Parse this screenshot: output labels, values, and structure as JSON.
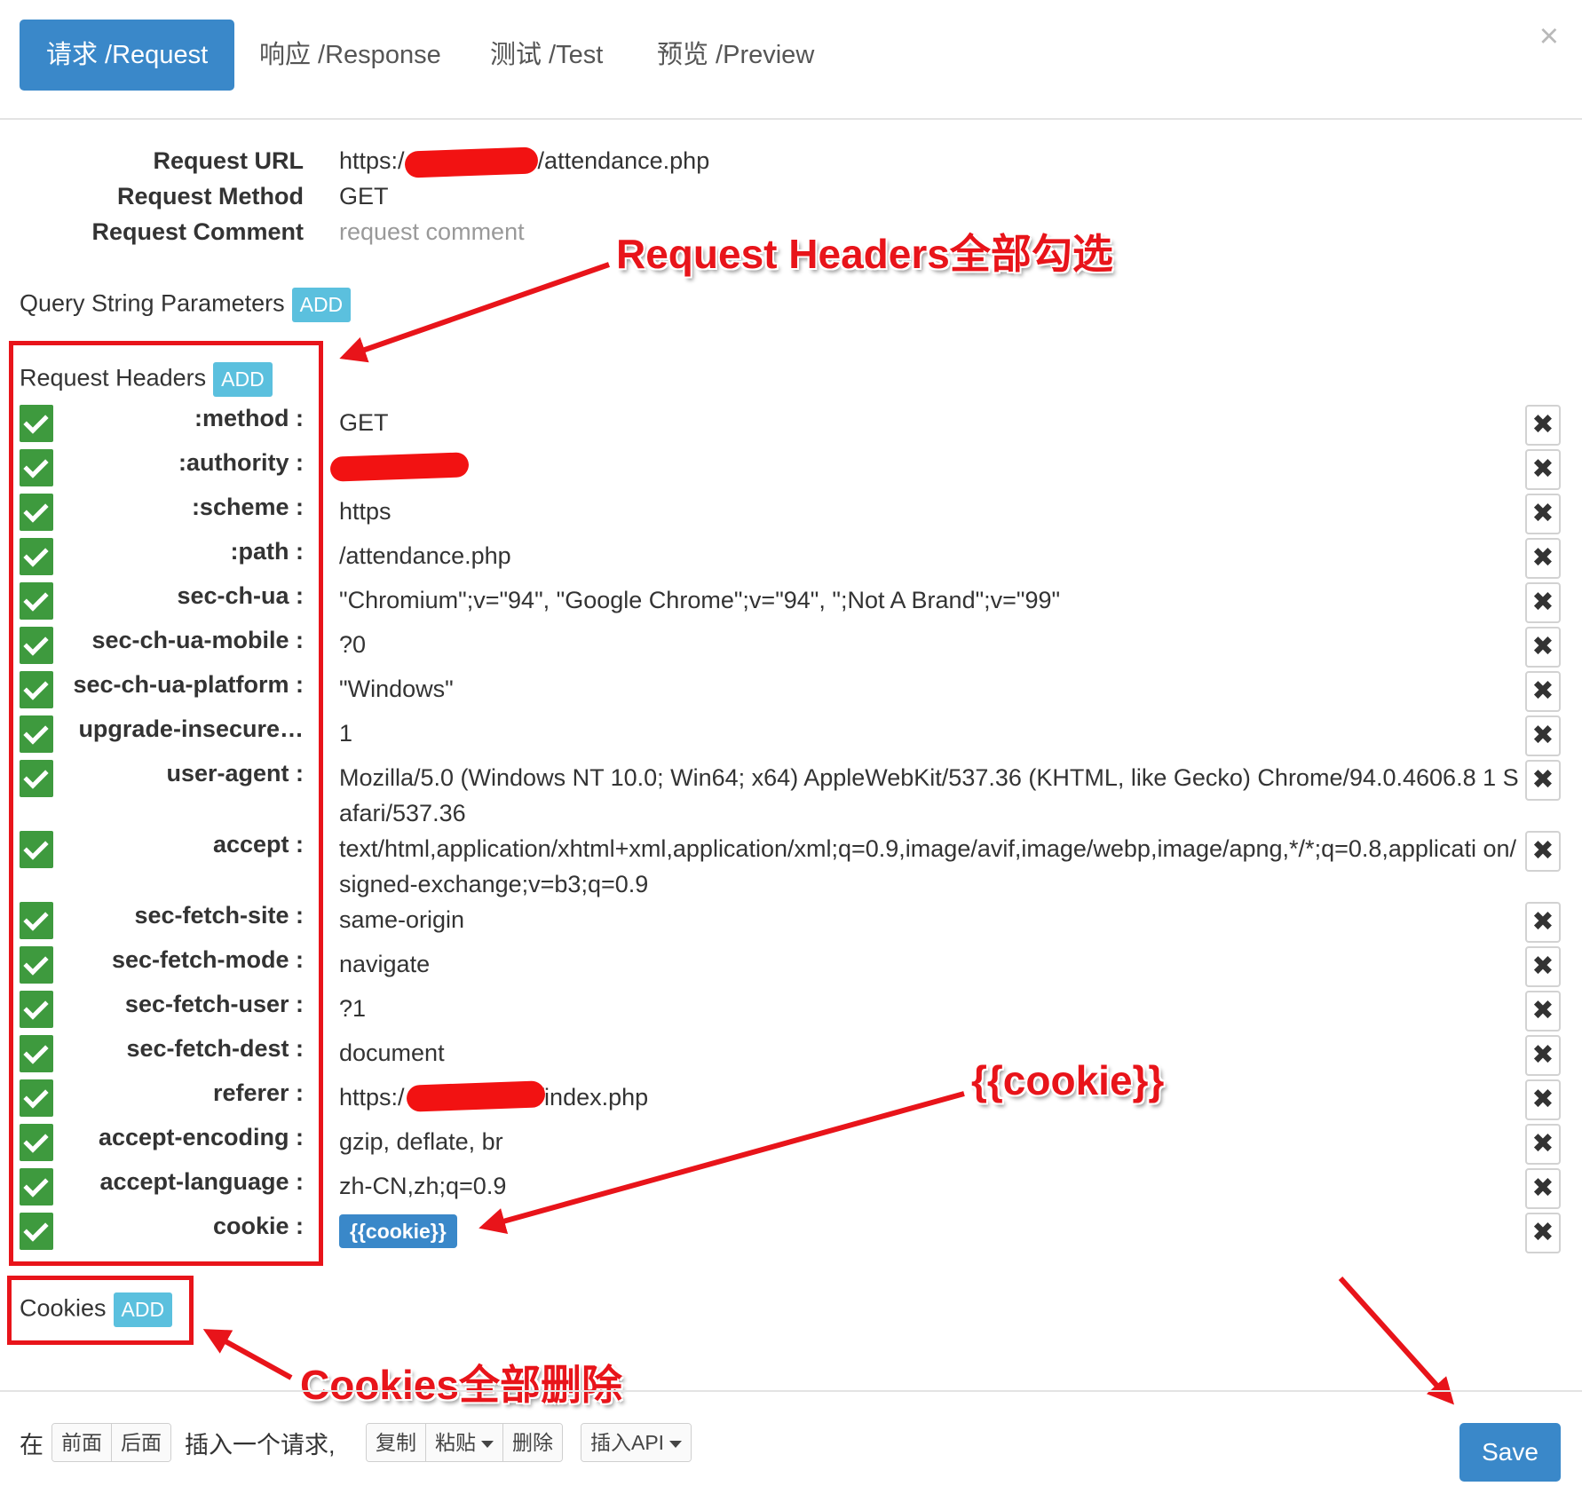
{
  "tabs": [
    "请求 /Request",
    "响应 /Response",
    "测试 /Test",
    "预览 /Preview"
  ],
  "close_icon": "×",
  "request": {
    "url_label": "Request URL",
    "url_prefix": "https:/",
    "url_suffix": "/attendance.php",
    "method_label": "Request Method",
    "method": "GET",
    "comment_label": "Request Comment",
    "comment_placeholder": "request comment"
  },
  "sections": {
    "query_label": "Query String Parameters",
    "headers_label": "Request Headers",
    "cookies_label": "Cookies",
    "add_label": "ADD"
  },
  "headers": [
    {
      "key": ":method :",
      "value": "GET"
    },
    {
      "key": ":authority :",
      "value": ""
    },
    {
      "key": ":scheme :",
      "value": "https"
    },
    {
      "key": ":path :",
      "value": "/attendance.php"
    },
    {
      "key": "sec-ch-ua :",
      "value": "\"Chromium\";v=\"94\", \"Google Chrome\";v=\"94\", \";Not A Brand\";v=\"99\""
    },
    {
      "key": "sec-ch-ua-mobile :",
      "value": "?0"
    },
    {
      "key": "sec-ch-ua-platform :",
      "value": "\"Windows\""
    },
    {
      "key": "upgrade-insecure…",
      "value": "1"
    },
    {
      "key": "user-agent :",
      "value": "Mozilla/5.0 (Windows NT 10.0; Win64; x64) AppleWebKit/537.36 (KHTML, like Gecko) Chrome/94.0.4606.8 1 Safari/537.36"
    },
    {
      "key": "accept :",
      "value": "text/html,application/xhtml+xml,application/xml;q=0.9,image/avif,image/webp,image/apng,*/*;q=0.8,applicati on/signed-exchange;v=b3;q=0.9"
    },
    {
      "key": "sec-fetch-site :",
      "value": "same-origin"
    },
    {
      "key": "sec-fetch-mode :",
      "value": "navigate"
    },
    {
      "key": "sec-fetch-user :",
      "value": "?1"
    },
    {
      "key": "sec-fetch-dest :",
      "value": "document"
    },
    {
      "key": "referer :",
      "value": "https:/",
      "value_suffix": "/index.php"
    },
    {
      "key": "accept-encoding :",
      "value": "gzip, deflate, br"
    },
    {
      "key": "accept-language :",
      "value": "zh-CN,zh;q=0.9"
    },
    {
      "key": "cookie :",
      "value": "{{cookie}}"
    }
  ],
  "annotations": {
    "headers_note": "Request Headers全部勾选",
    "cookie_note": "{{cookie}}",
    "cookies_note": "Cookies全部删除"
  },
  "footer": {
    "prefix": "在",
    "before": "前面",
    "after": "后面",
    "insert_request": "插入一个请求,",
    "copy": "复制",
    "paste": "粘贴",
    "delete": "删除",
    "insert_api": "插入API",
    "save": "Save"
  },
  "colors": {
    "primary": "#3a88c9",
    "add": "#5bc0de",
    "check": "#3e9a3e",
    "annotation": "#e8141a"
  }
}
